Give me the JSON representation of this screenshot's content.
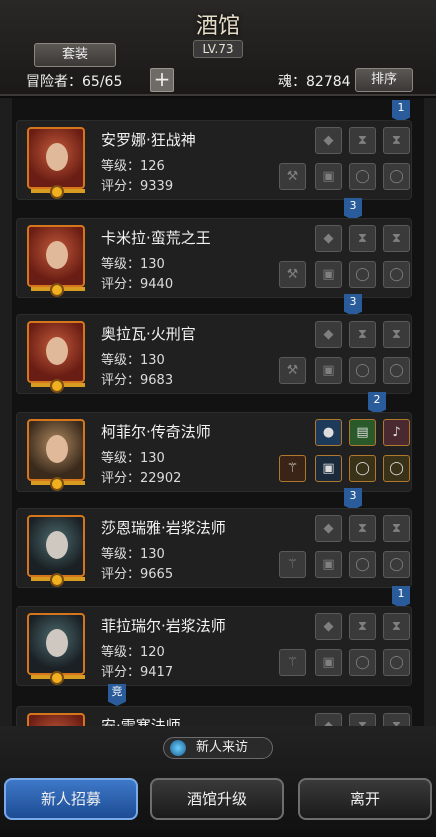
{
  "header": {
    "title": "酒馆",
    "level": "LV.73",
    "outfit_label": "套装",
    "adventurer_label": "冒险者：65/65",
    "soul_label": "魂：82784",
    "sort_label": "排序",
    "add_symbol": "+"
  },
  "heroes": [
    {
      "name": "安罗娜·狂战神",
      "level": "等级：126",
      "score": "评分：9339",
      "badge": "1"
    },
    {
      "name": "卡米拉·蛮荒之王",
      "level": "等级：130",
      "score": "评分：9440",
      "badge": "3"
    },
    {
      "name": "奥拉瓦·火刑官",
      "level": "等级：130",
      "score": "评分：9683",
      "badge": "3"
    },
    {
      "name": "柯菲尔·传奇法师",
      "level": "等级：130",
      "score": "评分：22902",
      "badge": "2"
    },
    {
      "name": "莎恩瑞雅·岩浆法师",
      "level": "等级：130",
      "score": "评分：9665",
      "badge": "3"
    },
    {
      "name": "菲拉瑞尔·岩浆法师",
      "level": "等级：120",
      "score": "评分：9417",
      "badge": "1"
    },
    {
      "name": "安·雷寒法师",
      "badge": "竞"
    }
  ],
  "footer": {
    "visit_label": "新人来访",
    "recruit_label": "新人招募",
    "upgrade_label": "酒馆升级",
    "leave_label": "离开"
  },
  "colors": {
    "accent_blue": "#2a5c9c",
    "frame_orange": "#d6761c",
    "active_button": "#3d78c8"
  }
}
